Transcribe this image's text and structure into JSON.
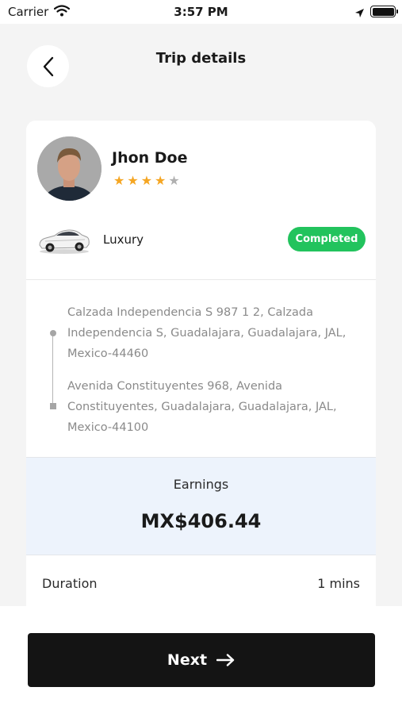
{
  "status_bar": {
    "carrier": "Carrier",
    "time": "3:57 PM"
  },
  "header": {
    "title": "Trip details",
    "back_icon": "chevron-left-icon"
  },
  "driver": {
    "name": "Jhon Doe",
    "rating": 4,
    "rating_max": 5,
    "star_color": "#f5a623",
    "star_empty_color": "#b0b0b0"
  },
  "vehicle": {
    "type": "Luxury",
    "icon": "car-icon"
  },
  "trip": {
    "status": "Completed",
    "status_color": "#22c35d",
    "pickup_address": "Calzada Independencia S 987 1 2, Calzada Independencia S, Guadalajara, Guadalajara, JAL, Mexico-44460",
    "dropoff_address": "Avenida Constituyentes 968, Avenida Constituyentes, Guadalajara, Guadalajara, JAL, Mexico-44100"
  },
  "earnings": {
    "label": "Earnings",
    "value": "MX$406.44"
  },
  "duration": {
    "label": "Duration",
    "value": "1 mins"
  },
  "footer": {
    "next_label": "Next",
    "next_icon": "arrow-right-icon"
  }
}
